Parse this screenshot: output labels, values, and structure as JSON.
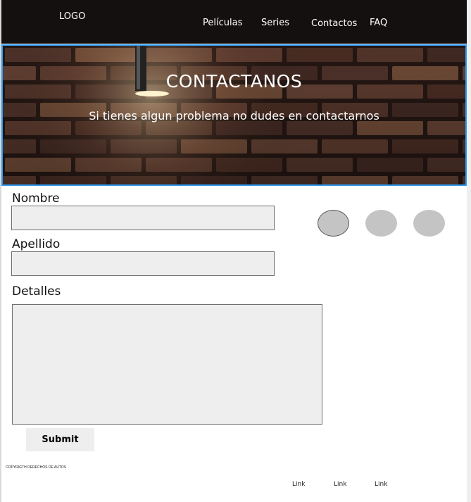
{
  "header": {
    "logo": "LOGO",
    "nav": [
      "Películas",
      "Series",
      "Contactos",
      "FAQ"
    ]
  },
  "hero": {
    "title": "CONTACTANOS",
    "subtitle": "Si tienes algun problema no dudes en contactarnos"
  },
  "form": {
    "nombre_label": "Nombre",
    "nombre_value": "",
    "apellido_label": "Apellido",
    "apellido_value": "",
    "detalles_label": "Detalles",
    "detalles_value": "",
    "submit_label": "Submit"
  },
  "footer": {
    "copyright": "COPYRIGTH DERECHOS DE AUTOS",
    "links": [
      "Link",
      "Link",
      "Link"
    ]
  },
  "colors": {
    "header_bg": "#151010",
    "hero_border": "#2f9bf0",
    "field_bg": "#eeeeee",
    "social_circle": "#c4c4c4"
  }
}
